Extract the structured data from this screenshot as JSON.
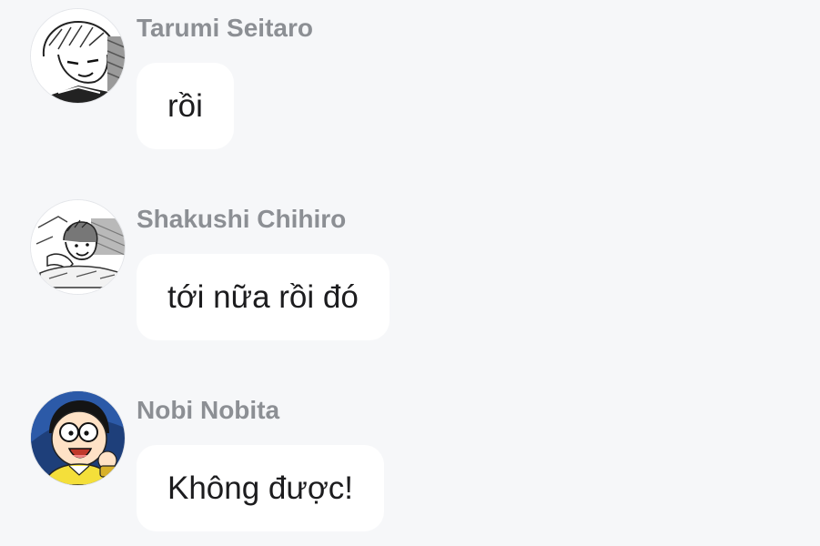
{
  "messages": [
    {
      "sender": "Tarumi Seitaro",
      "text": "rồi",
      "avatar": "manga-boy-smirking-avatar"
    },
    {
      "sender": "Shakushi Chihiro",
      "text": "tới nữa rồi đó",
      "avatar": "manga-boy-lying-in-bed-avatar"
    },
    {
      "sender": "Nobi Nobita",
      "text": "Không được!",
      "avatar": "nobita-cartoon-avatar"
    }
  ],
  "colors": {
    "background": "#f6f7f9",
    "bubble": "#ffffff",
    "sender_name": "#8c8f94",
    "message_text": "#1c1c1e"
  }
}
